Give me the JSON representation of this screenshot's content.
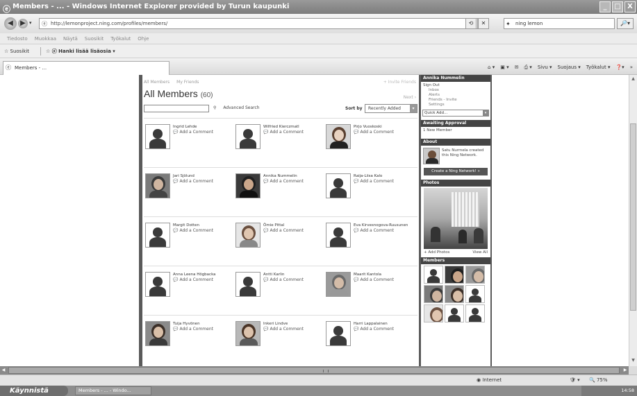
{
  "window": {
    "title": "Members - ... - Windows Internet Explorer provided by Turun kaupunki",
    "min_label": "_",
    "max_label": "□",
    "close_label": "X"
  },
  "address": {
    "back_label": "◀",
    "fwd_label": "▶",
    "url": "http://lemonproject.ning.com/profiles/members/",
    "refresh_label": "⟲",
    "stop_label": "✕",
    "search_value": "ning lemon",
    "search_btn_label": "🔎▾"
  },
  "menu": [
    "Tiedosto",
    "Muokkaa",
    "Näytä",
    "Suosikit",
    "Työkalut",
    "Ohje"
  ],
  "favbar": {
    "favorites_label": "Suosikit",
    "suggested_label": "Hanki lisää lisäosia ▾"
  },
  "tab": {
    "label": "Members - ..."
  },
  "cmdbar": {
    "home_label": "⌂ ▾",
    "feeds_label": "▣ ▾",
    "mail_label": "✉",
    "print_label": "⎙ ▾",
    "page_label": "Sivu ▾",
    "safety_label": "Suojaus ▾",
    "tools_label": "Työkalut ▾",
    "help_label": "❓▾",
    "more_label": "»"
  },
  "ning": {
    "subnav": [
      "All Members",
      "My Friends"
    ],
    "invite_label": "+ Invite Friends",
    "title": "All Members",
    "count": "(60)",
    "next_label": "Next ›",
    "advanced_search_label": "Advanced Search",
    "sort_label": "Sort by",
    "sort_value": "Recently Added",
    "add_comment_label": "Add a Comment",
    "members": [
      [
        "Ingrid Lehde",
        "Wilfried Kierczmatl",
        "Pirjo Vuoskoski"
      ],
      [
        "Jari Sjölund",
        "Annika Nummelin",
        "Raija-Liisa Kalo"
      ],
      [
        "Margit Dotten",
        "Ömie Pittal",
        "Eva Kirvesnogova-Ruusunen"
      ],
      [
        "Anna Leena Högbacka",
        "Antti Karlin",
        "Maarit Kantola"
      ],
      [
        "Tuija Hyvönen",
        "Inkeri Lindve",
        "Harri Lappalainen"
      ]
    ],
    "avatar_types": [
      [
        "silhouette",
        "silhouette",
        "photo-woman"
      ],
      [
        "photo-man",
        "photo-woman-dark",
        "silhouette"
      ],
      [
        "silhouette",
        "photo-woman-light",
        "silhouette"
      ],
      [
        "silhouette",
        "silhouette",
        "photo-closeup"
      ],
      [
        "photo-woman-smile",
        "photo-woman-curly",
        "silhouette"
      ]
    ]
  },
  "sidebar": {
    "user_name": "Annika Nummelin",
    "sign_out": "Sign Out",
    "links": [
      "Inbox",
      "Alerts",
      "Friends - Invite",
      "Settings"
    ],
    "quick_add": "Quick Add...",
    "awaiting_head": "Awaiting Approval",
    "awaiting_item": "1 New Member",
    "about_head": "About",
    "about_text": "Satu Nurmela created this Ning Network.",
    "create_btn": "Create a Ning Network! »",
    "photos_head": "Photos",
    "add_photos": "+ Add Photos",
    "view_all": "View All",
    "members_head": "Members"
  },
  "status": {
    "zone": "Internet",
    "zoom": "75%",
    "security_label": "🛡 ▾"
  },
  "taskbar": {
    "start": "Käynnistä",
    "task": "Members - ... - Windo...",
    "clock": "14:58"
  }
}
